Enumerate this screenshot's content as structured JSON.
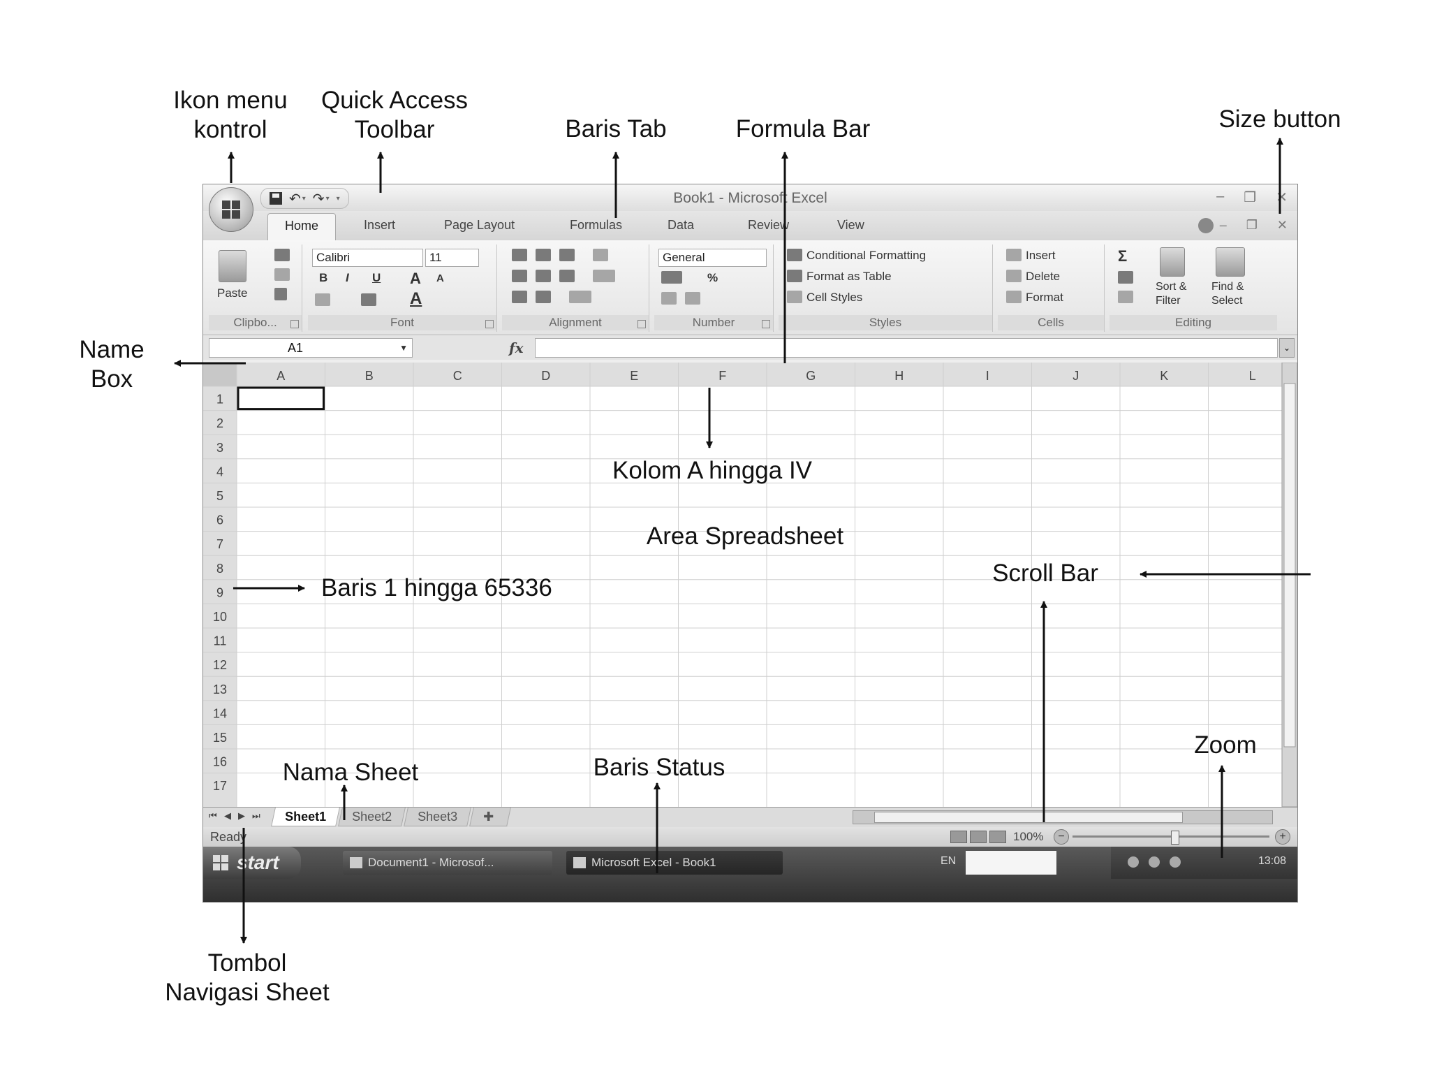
{
  "excel": {
    "window_title": "Book1 - Microsoft Excel",
    "tabs": [
      "Home",
      "Insert",
      "Page Layout",
      "Formulas",
      "Data",
      "Review",
      "View"
    ],
    "clipboard": {
      "paste": "Paste",
      "label": "Clipbo..."
    },
    "font": {
      "name": "Calibri",
      "size": "11",
      "bold": "B",
      "italic": "I",
      "underline": "U",
      "grow": "A",
      "shrink": "A",
      "color": "A",
      "label": "Font"
    },
    "alignment": {
      "label": "Alignment"
    },
    "number": {
      "format": "General",
      "percent": "%",
      "label": "Number"
    },
    "styles": {
      "conditional": "Conditional Formatting",
      "table": "Format as Table",
      "cell": "Cell Styles",
      "label": "Styles"
    },
    "cells": {
      "insert": "Insert",
      "delete": "Delete",
      "format": "Format",
      "label": "Cells"
    },
    "editing": {
      "sigma": "Σ",
      "sort": "Sort &",
      "sort2": "Filter",
      "find": "Find &",
      "find2": "Select",
      "label": "Editing"
    },
    "name_box": "A1",
    "fx": "fx",
    "columns": [
      "A",
      "B",
      "C",
      "D",
      "E",
      "F",
      "G",
      "H",
      "I",
      "J",
      "K",
      "L"
    ],
    "rows": [
      "1",
      "2",
      "3",
      "4",
      "5",
      "6",
      "7",
      "8",
      "9",
      "10",
      "11",
      "12",
      "13",
      "14",
      "15",
      "16",
      "17"
    ],
    "sheets": [
      "Sheet1",
      "Sheet2",
      "Sheet3"
    ],
    "status": "Ready",
    "zoom": "100%",
    "zoom_minus": "−",
    "zoom_plus": "+",
    "taskbar": {
      "start": "start",
      "task1": "Document1 - Microsof...",
      "task2": "Microsoft Excel - Book1",
      "lang": "EN",
      "clock": "13:08"
    }
  },
  "annotations": {
    "ikon_menu_1": "Ikon menu",
    "ikon_menu_2": "kontrol",
    "qat_1": "Quick Access",
    "qat_2": "Toolbar",
    "baris_tab": "Baris Tab",
    "formula_bar": "Formula Bar",
    "size_button": "Size button",
    "name_box_1": "Name",
    "name_box_2": "Box",
    "kolom": "Kolom A hingga IV",
    "area": "Area Spreadsheet",
    "baris": "Baris 1 hingga 65336",
    "scroll": "Scroll  Bar",
    "zoom": "Zoom",
    "nama_sheet": "Nama Sheet",
    "baris_status": "Baris Status",
    "tombol_1": "Tombol",
    "tombol_2": "Navigasi Sheet"
  }
}
